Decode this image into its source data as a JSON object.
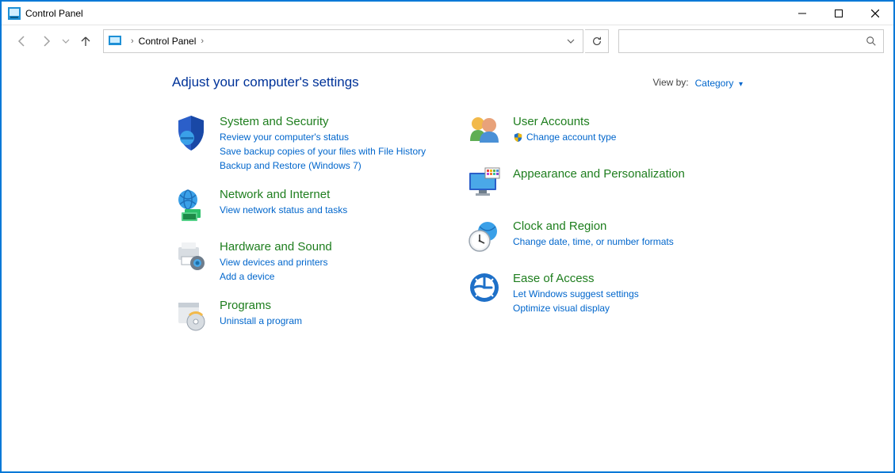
{
  "window": {
    "title": "Control Panel"
  },
  "address": {
    "crumb_root": "Control Panel",
    "chevron": "›"
  },
  "search": {
    "placeholder": ""
  },
  "heading": "Adjust your computer's settings",
  "viewby": {
    "label": "View by:",
    "value": "Category"
  },
  "left_categories": [
    {
      "id": "system-security",
      "title": "System and Security",
      "tasks": [
        "Review your computer's status",
        "Save backup copies of your files with File History",
        "Backup and Restore (Windows 7)"
      ]
    },
    {
      "id": "network-internet",
      "title": "Network and Internet",
      "tasks": [
        "View network status and tasks"
      ]
    },
    {
      "id": "hardware-sound",
      "title": "Hardware and Sound",
      "tasks": [
        "View devices and printers",
        "Add a device"
      ]
    },
    {
      "id": "programs",
      "title": "Programs",
      "tasks": [
        "Uninstall a program"
      ]
    }
  ],
  "right_categories": [
    {
      "id": "user-accounts",
      "title": "User Accounts",
      "tasks": [
        "Change account type"
      ],
      "task_shield": [
        true
      ]
    },
    {
      "id": "appearance-personalization",
      "title": "Appearance and Personalization",
      "tasks": []
    },
    {
      "id": "clock-region",
      "title": "Clock and Region",
      "tasks": [
        "Change date, time, or number formats"
      ]
    },
    {
      "id": "ease-of-access",
      "title": "Ease of Access",
      "tasks": [
        "Let Windows suggest settings",
        "Optimize visual display"
      ]
    }
  ]
}
